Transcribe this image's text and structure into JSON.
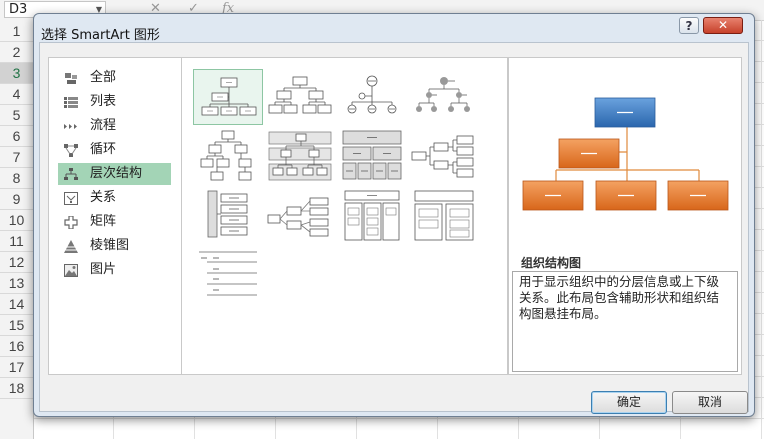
{
  "excel": {
    "name_box": "D3",
    "formula_icons": [
      "✕",
      "✓",
      "fx"
    ],
    "row_numbers": [
      "1",
      "2",
      "3",
      "4",
      "5",
      "6",
      "7",
      "8",
      "9",
      "10",
      "11",
      "12",
      "13",
      "14",
      "15",
      "16",
      "17",
      "18"
    ],
    "selected_row": "3"
  },
  "dialog": {
    "title": "选择 SmartArt 图形",
    "help_label": "?",
    "close_label": "✕",
    "categories": [
      {
        "label": "全部",
        "icon": "all-icon"
      },
      {
        "label": "列表",
        "icon": "list-icon"
      },
      {
        "label": "流程",
        "icon": "process-icon"
      },
      {
        "label": "循环",
        "icon": "cycle-icon"
      },
      {
        "label": "层次结构",
        "icon": "hierarchy-icon",
        "selected": true
      },
      {
        "label": "关系",
        "icon": "relationship-icon"
      },
      {
        "label": "矩阵",
        "icon": "matrix-icon"
      },
      {
        "label": "棱锥图",
        "icon": "pyramid-icon"
      },
      {
        "label": "图片",
        "icon": "picture-icon"
      }
    ],
    "preview": {
      "title": "组织结构图",
      "description": "用于显示组织中的分层信息或上下级关系。此布局包含辅助形状和组织结构图悬挂布局。"
    },
    "ok_label": "确定",
    "cancel_label": "取消"
  },
  "colors": {
    "selection_green": "#a3d4b6",
    "preview_top_blue": "#2f6fb3",
    "preview_orange": "#e07a24"
  }
}
